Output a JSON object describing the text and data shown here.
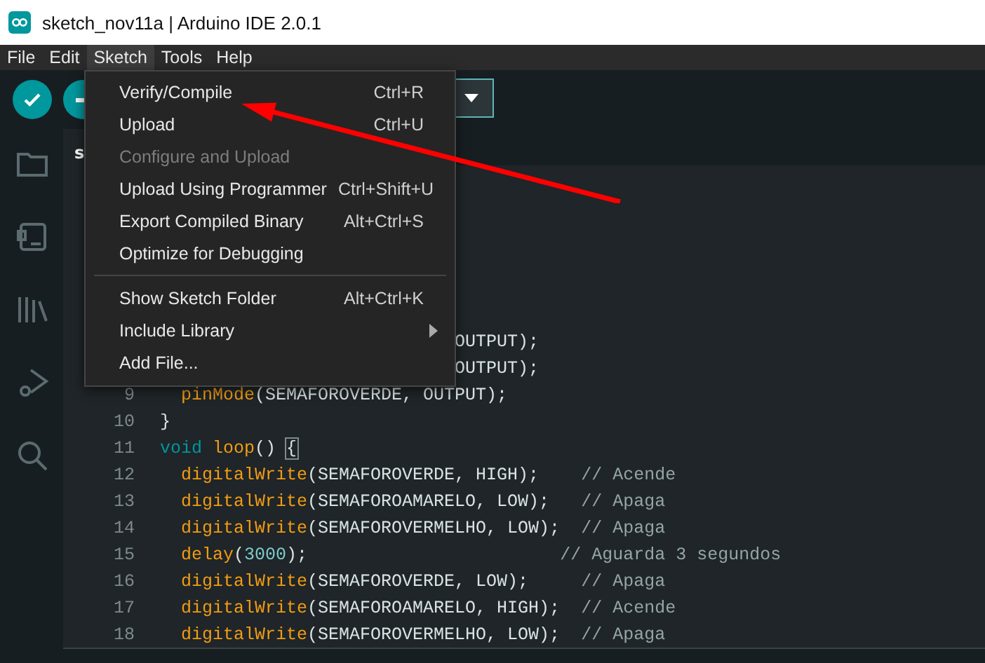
{
  "window": {
    "title": "sketch_nov11a | Arduino IDE 2.0.1"
  },
  "menubar": [
    {
      "label": "File",
      "selected": false
    },
    {
      "label": "Edit",
      "selected": false
    },
    {
      "label": "Sketch",
      "selected": true
    },
    {
      "label": "Tools",
      "selected": false
    },
    {
      "label": "Help",
      "selected": false
    }
  ],
  "sketch_menu": [
    {
      "kind": "item",
      "label": "Verify/Compile",
      "shortcut": "Ctrl+R",
      "disabled": false
    },
    {
      "kind": "item",
      "label": "Upload",
      "shortcut": "Ctrl+U",
      "disabled": false
    },
    {
      "kind": "item",
      "label": "Configure and Upload",
      "disabled": true
    },
    {
      "kind": "item",
      "label": "Upload Using Programmer",
      "shortcut": "Ctrl+Shift+U",
      "disabled": false
    },
    {
      "kind": "item",
      "label": "Export Compiled Binary",
      "shortcut": "Alt+Ctrl+S",
      "disabled": false
    },
    {
      "kind": "item",
      "label": "Optimize for Debugging",
      "disabled": false
    },
    {
      "kind": "separator"
    },
    {
      "kind": "item",
      "label": "Show Sketch Folder",
      "shortcut": "Alt+Ctrl+K",
      "disabled": false
    },
    {
      "kind": "submenu",
      "label": "Include Library",
      "disabled": false
    },
    {
      "kind": "item",
      "label": "Add File...",
      "disabled": false
    }
  ],
  "editor_tab": {
    "label": "s"
  },
  "code_lines": [
    {
      "tokens": [
        {
          "kind": "plain",
          "text": "OUTPUT);"
        }
      ]
    },
    {
      "tokens": [
        {
          "kind": "plain",
          "text": "OUTPUT);"
        }
      ]
    },
    {
      "number": "9",
      "tokens": [
        {
          "kind": "fn",
          "text": "  pinMode"
        },
        {
          "kind": "plain",
          "text": "(SEMAFOROVERDE, OUTPUT);"
        }
      ]
    },
    {
      "number": "10",
      "tokens": [
        {
          "kind": "plain",
          "text": "}"
        }
      ]
    },
    {
      "number": "11",
      "tokens": [
        {
          "kind": "keyword",
          "text": "void "
        },
        {
          "kind": "fn",
          "text": "loop"
        },
        {
          "kind": "plain",
          "text": "() "
        },
        {
          "kind": "bracket",
          "text": "{"
        }
      ]
    },
    {
      "number": "12",
      "tokens": [
        {
          "kind": "fn",
          "text": "  digitalWrite"
        },
        {
          "kind": "plain",
          "text": "(SEMAFOROVERDE, HIGH);    "
        },
        {
          "kind": "comment",
          "text": "// Acende"
        }
      ]
    },
    {
      "number": "13",
      "tokens": [
        {
          "kind": "fn",
          "text": "  digitalWrite"
        },
        {
          "kind": "plain",
          "text": "(SEMAFOROAMARELO, LOW);   "
        },
        {
          "kind": "comment",
          "text": "// Apaga"
        }
      ]
    },
    {
      "number": "14",
      "tokens": [
        {
          "kind": "fn",
          "text": "  digitalWrite"
        },
        {
          "kind": "plain",
          "text": "(SEMAFOROVERMELHO, LOW);  "
        },
        {
          "kind": "comment",
          "text": "// Apaga"
        }
      ]
    },
    {
      "number": "15",
      "tokens": [
        {
          "kind": "fn",
          "text": "  delay"
        },
        {
          "kind": "plain",
          "text": "("
        },
        {
          "kind": "number",
          "text": "3000"
        },
        {
          "kind": "plain",
          "text": ");                        "
        },
        {
          "kind": "comment",
          "text": "// Aguarda 3 segundos"
        }
      ]
    },
    {
      "number": "16",
      "tokens": [
        {
          "kind": "fn",
          "text": "  digitalWrite"
        },
        {
          "kind": "plain",
          "text": "(SEMAFOROVERDE, LOW);     "
        },
        {
          "kind": "comment",
          "text": "// Apaga"
        }
      ]
    },
    {
      "number": "17",
      "tokens": [
        {
          "kind": "fn",
          "text": "  digitalWrite"
        },
        {
          "kind": "plain",
          "text": "(SEMAFOROAMARELO, HIGH);  "
        },
        {
          "kind": "comment",
          "text": "// Acende"
        }
      ]
    },
    {
      "number": "18",
      "tokens": [
        {
          "kind": "fn",
          "text": "  digitalWrite"
        },
        {
          "kind": "plain",
          "text": "(SEMAFOROVERMELHO, LOW);  "
        },
        {
          "kind": "comment",
          "text": "// Apaga"
        }
      ]
    }
  ]
}
